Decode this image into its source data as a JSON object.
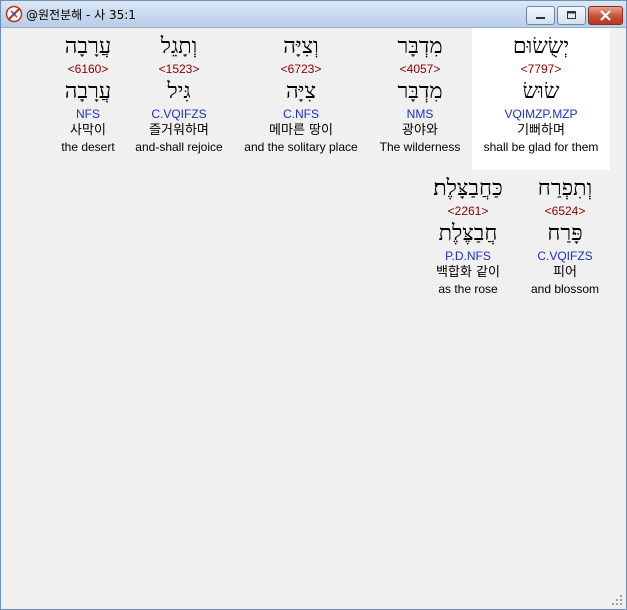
{
  "window": {
    "title": "@원전분해 - 사 35:1",
    "icon": "app-logo-icon",
    "controls": [
      "minimize-icon",
      "maximize-icon",
      "close-icon"
    ]
  },
  "words": [
    {
      "hebrew": "יְשֻׂשׂוּם",
      "strong": "<7797>",
      "lemma": "שׂוּשׂ",
      "parse": "VQIMZP.MZP",
      "korean": "기뻐하며",
      "english": "shall be glad for them",
      "selected": true
    },
    {
      "hebrew": "מִדְבָּר",
      "strong": "<4057>",
      "lemma": "מִדְבָּר",
      "parse": "NMS",
      "korean": "광야와",
      "english": "The wilderness",
      "selected": false
    },
    {
      "hebrew": "וְצִיָּה",
      "strong": "<6723>",
      "lemma": "צִיָּה",
      "parse": "C.NFS",
      "korean": "메마른 땅이",
      "english": "and the solitary place",
      "selected": false
    },
    {
      "hebrew": "וְתָגֵל",
      "strong": "<1523>",
      "lemma": "גִּיל",
      "parse": "C.VQIFZS",
      "korean": "즐거워하며",
      "english": "and-shall rejoice",
      "selected": false
    },
    {
      "hebrew": "עֲרָבָה",
      "strong": "<6160>",
      "lemma": "עֲרָבָה",
      "parse": "NFS",
      "korean": "사막이",
      "english": "the desert",
      "selected": false
    },
    {
      "hebrew": "וְתִפְרַח",
      "strong": "<6524>",
      "lemma": "פָּרַח",
      "parse": "C.VQIFZS",
      "korean": "피어",
      "english": "and blossom",
      "selected": false
    },
    {
      "hebrew": "כַּחֲבַצָּלֶת׃",
      "strong": "<2261>",
      "lemma": "חֲבַצֶּלֶת",
      "parse": "P.D.NFS",
      "korean": "백합화 같이",
      "english": "as the rose",
      "selected": false
    }
  ],
  "colors": {
    "strong": "#8b0000",
    "parse": "#2030c0",
    "highlight": "#ffffff",
    "background": "#f0f0f0"
  }
}
